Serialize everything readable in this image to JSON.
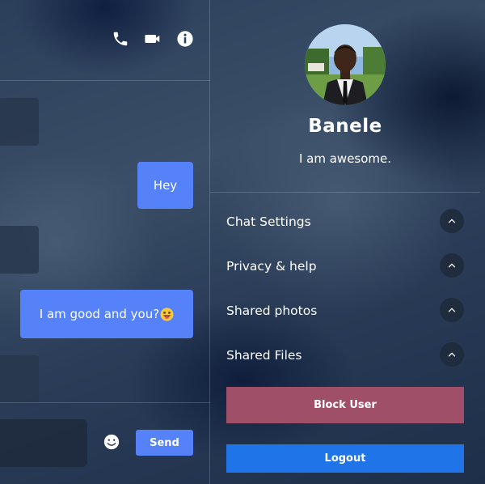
{
  "chat": {
    "header_icons": [
      "phone-icon",
      "video-camera-icon",
      "info-icon"
    ],
    "messages": [
      {
        "direction": "incoming",
        "text": ""
      },
      {
        "direction": "outgoing",
        "text": "Hey"
      },
      {
        "direction": "incoming",
        "text": ""
      },
      {
        "direction": "outgoing",
        "text": "I am good and you?",
        "emoji": "grinning-tongue-emoji"
      },
      {
        "direction": "incoming",
        "text": ""
      }
    ],
    "composer": {
      "input_value": "",
      "input_placeholder": "",
      "emoji_icon": "smiley-icon",
      "send_label": "Send"
    }
  },
  "profile": {
    "avatar_icon": "user-avatar",
    "name": "Banele",
    "status": "I am awesome.",
    "sections": [
      {
        "label": "Chat Settings",
        "icon": "chevron-up-icon"
      },
      {
        "label": "Privacy & help",
        "icon": "chevron-up-icon"
      },
      {
        "label": "Shared photos",
        "icon": "chevron-up-icon"
      },
      {
        "label": "Shared Files",
        "icon": "chevron-up-icon"
      }
    ],
    "block_label": "Block User",
    "logout_label": "Logout"
  },
  "colors": {
    "accent": "#5582f8",
    "block": "#a04f68",
    "logout": "#1f74e8"
  }
}
